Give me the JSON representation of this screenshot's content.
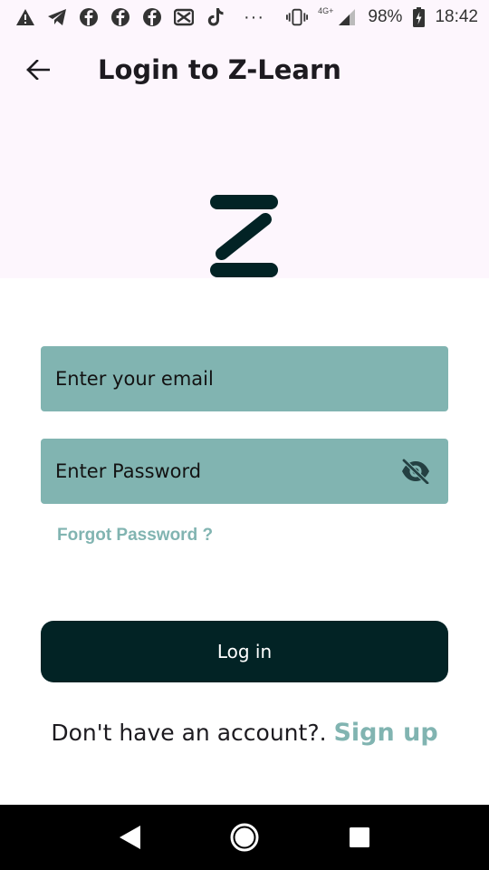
{
  "status_bar": {
    "battery": "98%",
    "time": "18:42",
    "network": "4G+",
    "more": "···",
    "left_icons": [
      "warning-icon",
      "telegram-icon",
      "facebook-icon",
      "facebook-icon",
      "facebook-icon",
      "capcut-icon",
      "tiktok-icon"
    ]
  },
  "app_bar": {
    "title": "Login to Z-Learn"
  },
  "form": {
    "email_placeholder": "Enter your email",
    "email_value": "",
    "password_placeholder": "Enter Password",
    "password_value": "",
    "forgot_label": "Forgot Password ?",
    "login_label": "Log in"
  },
  "signup": {
    "prompt": "Don't have an account?. ",
    "link": "Sign up"
  },
  "colors": {
    "accent": "#81b4b1",
    "dark": "#022325",
    "header_bg": "#fdf6fd"
  }
}
